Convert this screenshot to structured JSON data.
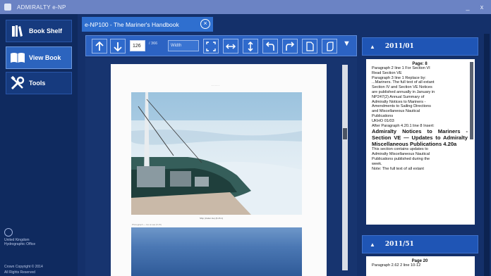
{
  "window": {
    "title": "ADMIRALTY e-NP",
    "minimize": "_",
    "close": "x"
  },
  "sidebar": {
    "items": [
      {
        "label": "Book Shelf",
        "icon": "book-shelf-icon"
      },
      {
        "label": "View Book",
        "icon": "open-book-icon"
      },
      {
        "label": "Tools",
        "icon": "tools-icon"
      }
    ],
    "org_lines": [
      "United Kingdom",
      "Hydrographic Office"
    ],
    "copyright": "Crown Copyright © 2014",
    "rights": "All Rights Reserved"
  },
  "tab": {
    "label": "e-NP100 - The Mariner's Handbook"
  },
  "toolbar": {
    "page_value": "126",
    "page_total": "/ 366",
    "zoom": "Width",
    "menu": "▼"
  },
  "page": {
    "header_text": "...............",
    "caption": "Ship (Under Ice) (6.15.1)",
    "caption2": "Photograph — Ice at sea (6.15)"
  },
  "notices": [
    {
      "heading": "2011/01",
      "title": "Page: 8",
      "lines": [
        "Paragraph 2 line 1 For Section VI",
        "Read Section VE",
        "Paragraph 3 line 1 Replace by:",
        "...Mariners. The full text of all extant",
        "Section IV and Section VE Notices",
        "are published annually in January in",
        "NP247(2) Annual Summary of",
        "Admiralty Notices to Mariners -",
        "Amendments to Sailing Directions",
        "and Miscellaneous Nautical",
        "Publications",
        "UKHO 01/03",
        "After Paragraph 4.20.1 line 8 Insert:"
      ],
      "bold": "Admiralty Notices to Mariners - Section VE — Updates to Admiralty Miscellaneous Publications 4.20a",
      "tail": [
        "This section contains updates to",
        "Admiralty Miscellaneous Nautical",
        "Publications published during the",
        "week.",
        "Note: The full text of all extant"
      ]
    },
    {
      "heading": "2011/51",
      "title": "Page 20",
      "lines": [
        "Paragraph 2.62 2 line 10-12"
      ]
    }
  ],
  "colors": {
    "accent": "#2c63c3",
    "background": "#14306a",
    "titlebar": "#6b83c4"
  }
}
